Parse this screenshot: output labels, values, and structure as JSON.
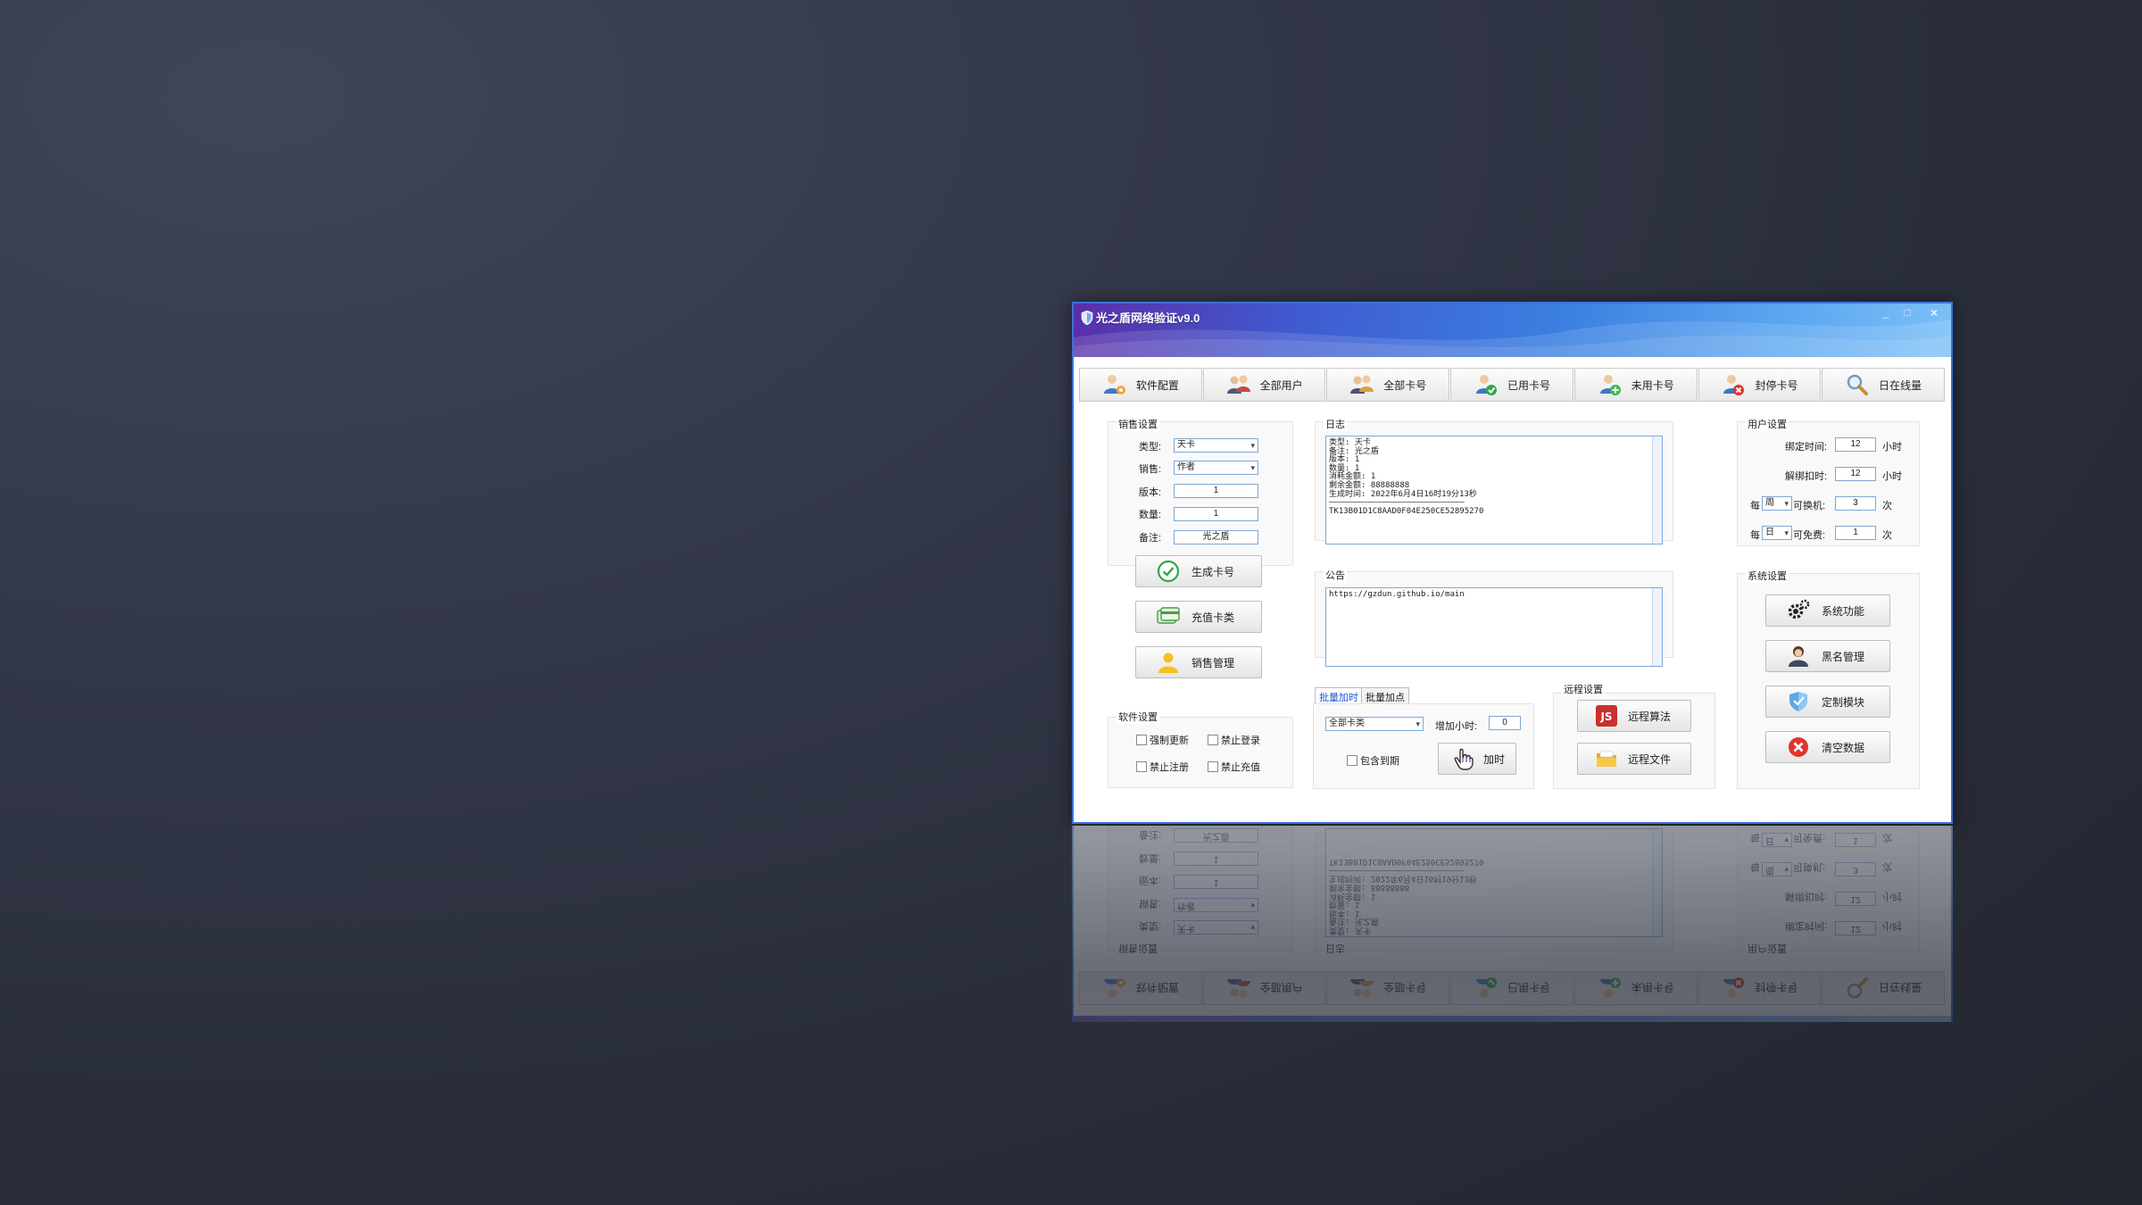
{
  "window": {
    "title": "光之盾网络验证v9.0",
    "controls": {
      "minimize": "_",
      "maximize": "□",
      "close": "×"
    }
  },
  "tabs": [
    {
      "label": "软件配置",
      "icon": "user-gear-icon"
    },
    {
      "label": "全部用户",
      "icon": "users-icon"
    },
    {
      "label": "全部卡号",
      "icon": "users-card-icon"
    },
    {
      "label": "已用卡号",
      "icon": "user-check-icon"
    },
    {
      "label": "未用卡号",
      "icon": "user-add-icon"
    },
    {
      "label": "封停卡号",
      "icon": "user-block-icon"
    },
    {
      "label": "日在线量",
      "icon": "search-icon"
    }
  ],
  "sales": {
    "title": "销售设置",
    "type_label": "类型:",
    "type_value": "天卡",
    "seller_label": "销售:",
    "seller_value": "作者",
    "version_label": "版本:",
    "version_value": "1",
    "quantity_label": "数量:",
    "quantity_value": "1",
    "note_label": "备注:",
    "note_value": "光之盾",
    "generate_button": "生成卡号",
    "recharge_button": "充值卡类",
    "manage_button": "销售管理"
  },
  "software": {
    "title": "软件设置",
    "force_update": "强制更新",
    "forbid_login": "禁止登录",
    "forbid_register": "禁止注册",
    "forbid_recharge": "禁止充值"
  },
  "log": {
    "title": "日志",
    "lines": [
      "类型: 天卡",
      "备注: 光之盾",
      "版本: 1",
      "数量: 1",
      "消耗金额: 1",
      "剩余金额: 88888888",
      "生成时间: 2022年6月4日16时19分13秒",
      "————————————————————————————",
      "TK13B01D1C8AAD0F04E250CE52895270"
    ]
  },
  "notice": {
    "title": "公告",
    "text": "https://gzdun.github.io/main"
  },
  "batch": {
    "tab_time": "批量加时",
    "tab_points": "批量加点",
    "card_type_value": "全部卡类",
    "hours_label": "增加小时:",
    "hours_value": "0",
    "include_expired": "包含到期",
    "add_time_button": "加时"
  },
  "remote": {
    "title": "远程设置",
    "algorithm_button": "远程算法",
    "file_button": "远程文件"
  },
  "user_settings": {
    "title": "用户设置",
    "bind_time_label": "绑定时间:",
    "bind_time_value": "12",
    "bind_time_unit": "小时",
    "unbind_deduct_label": "解绑扣时:",
    "unbind_deduct_value": "12",
    "unbind_deduct_unit": "小时",
    "every1_label": "每",
    "every1_value": "周",
    "change_machine_label": "可换机:",
    "change_machine_value": "3",
    "times1_unit": "次",
    "every2_label": "每",
    "every2_value": "日",
    "free_label": "可免费:",
    "free_value": "1",
    "times2_unit": "次"
  },
  "system": {
    "title": "系统设置",
    "functions_button": "系统功能",
    "blacklist_button": "黑名管理",
    "custom_module_button": "定制模块",
    "clear_data_button": "清空数据"
  },
  "colors": {
    "accent": "#3b7fe0",
    "title_gradient_start": "#5a2fa8",
    "title_gradient_end": "#7cc0f7",
    "field_border": "#7ea7d8",
    "active_subtab": "#1b57d8"
  }
}
